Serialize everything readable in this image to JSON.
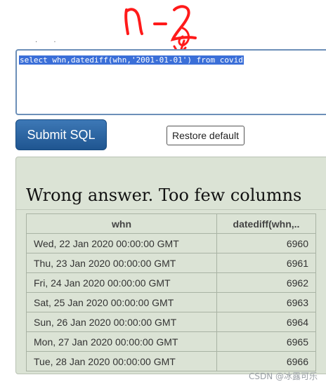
{
  "page_dots": ". .",
  "annotation": {
    "text": "n-2"
  },
  "sql": {
    "query": "select whn,datediff(whn,'2001-01-01') from covid"
  },
  "buttons": {
    "submit": "Submit SQL",
    "restore": "Restore default"
  },
  "result": {
    "title": "Wrong answer. Too few columns",
    "columns": [
      "whn",
      "datediff(whn,.."
    ],
    "rows": [
      [
        "Wed, 22 Jan 2020 00:00:00 GMT",
        "6960"
      ],
      [
        "Thu, 23 Jan 2020 00:00:00 GMT",
        "6961"
      ],
      [
        "Fri, 24 Jan 2020 00:00:00 GMT",
        "6962"
      ],
      [
        "Sat, 25 Jan 2020 00:00:00 GMT",
        "6963"
      ],
      [
        "Sun, 26 Jan 2020 00:00:00 GMT",
        "6964"
      ],
      [
        "Mon, 27 Jan 2020 00:00:00 GMT",
        "6965"
      ],
      [
        "Tue, 28 Jan 2020 00:00:00 GMT",
        "6966"
      ]
    ]
  },
  "watermark": "CSDN @冰露可乐"
}
